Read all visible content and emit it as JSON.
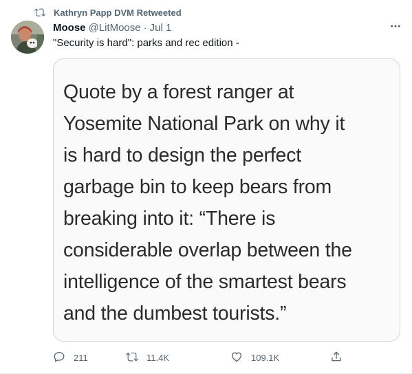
{
  "retweet_context": {
    "text": "Kathryn Papp DVM Retweeted",
    "icon": "retweet-icon"
  },
  "author": {
    "name": "Moose",
    "handle": "@LitMoose",
    "separator": "·",
    "date": "Jul 1"
  },
  "tweet": {
    "text": "\"Security is hard\": parks and rec edition -"
  },
  "media": {
    "lines": [
      "Quote by a forest ranger at",
      "Yosemite National Park on why it",
      "is hard to design the perfect",
      "garbage bin to keep bears from",
      "breaking into it:  “There is",
      "considerable overlap between the",
      "intelligence of the smartest bears",
      "and the dumbest tourists.”"
    ]
  },
  "actions": {
    "replies": "211",
    "retweets": "11.4K",
    "likes": "109.1K"
  },
  "colors": {
    "secondary_text": "#536471",
    "primary_text": "#0f1419",
    "border": "#cfd9de"
  }
}
